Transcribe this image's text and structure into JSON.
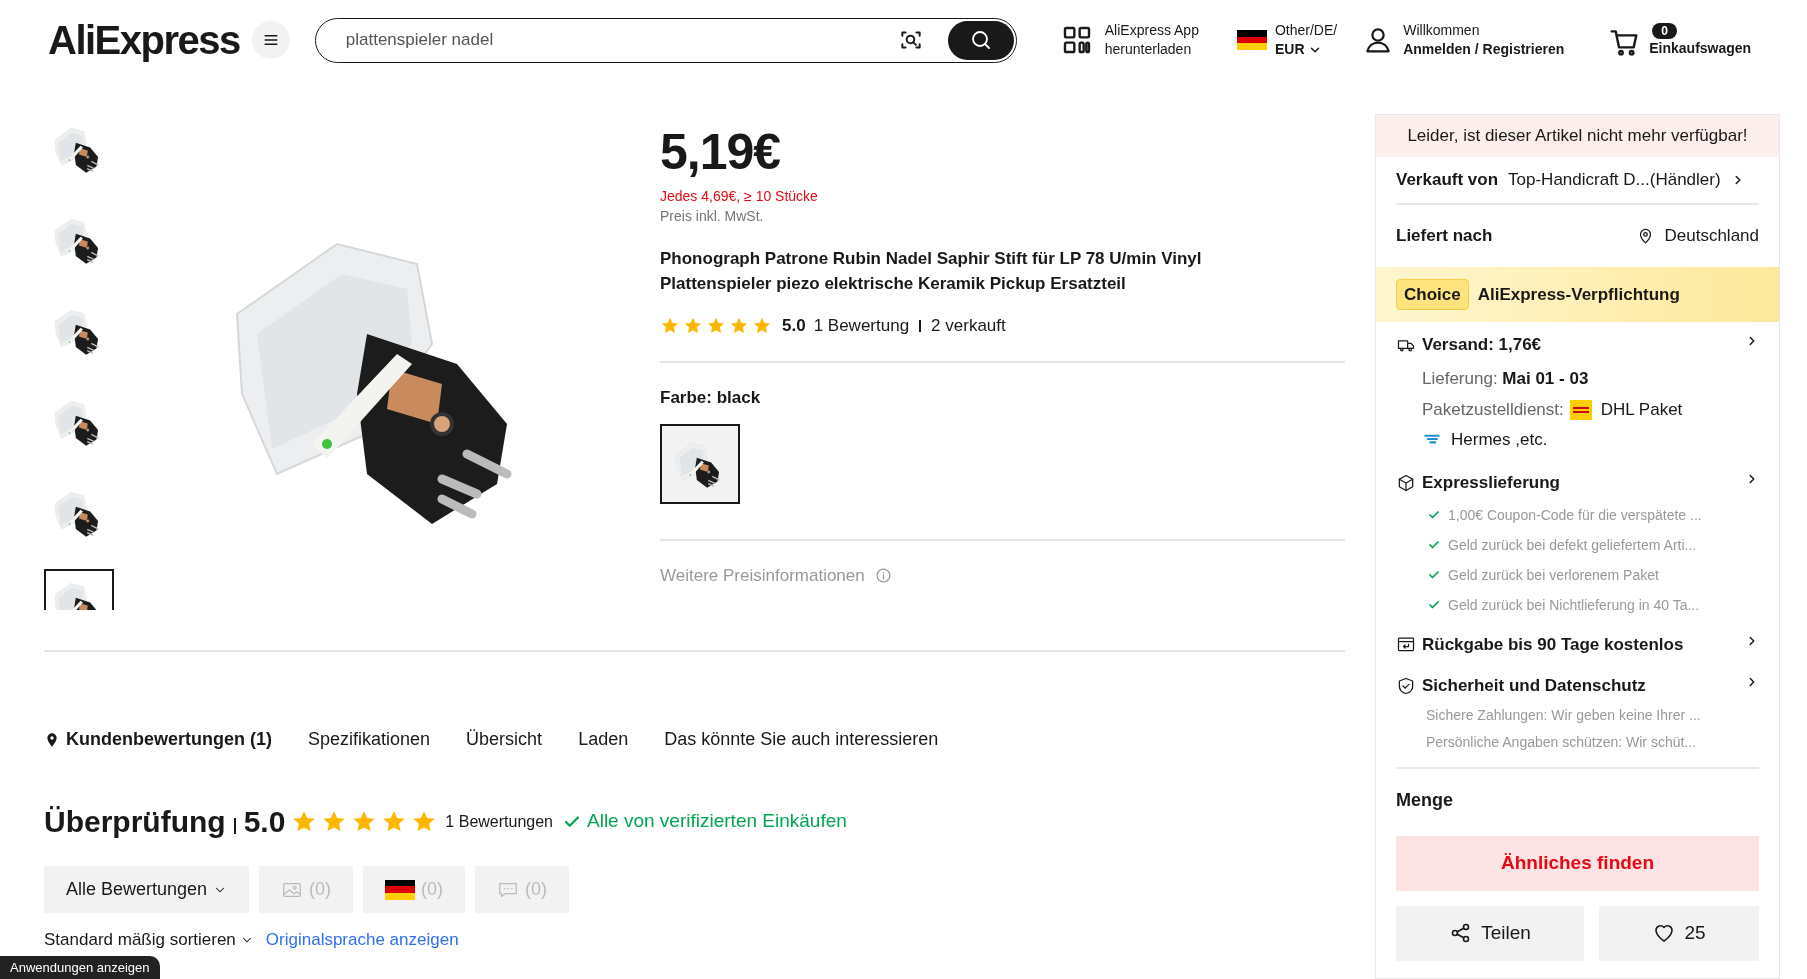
{
  "header": {
    "logo": "AliExpress",
    "search": {
      "value": "plattenspieler nadel"
    },
    "app": {
      "line1": "AliExpress App",
      "line2": "herunterladen"
    },
    "region": {
      "line1": "Other/DE/",
      "line2": "EUR"
    },
    "account": {
      "line1": "Willkommen",
      "line2": "Anmelden / Registrieren"
    },
    "cart": {
      "count": "0",
      "label": "Einkaufswagen"
    }
  },
  "gallery": [
    {
      "selected": false
    },
    {
      "selected": false
    },
    {
      "selected": false
    },
    {
      "selected": false
    },
    {
      "selected": false
    },
    {
      "selected": true
    }
  ],
  "product": {
    "price": "5,19€",
    "bulk_price": "Jedes 4,69€, ≥ 10 Stücke",
    "tax_note": "Preis inkl. MwSt.",
    "title": "Phonograph Patrone Rubin Nadel Saphir Stift für LP 78 U/min Vinyl Plattenspieler piezo elektrische Keramik Pickup Ersatzteil",
    "stars": 5,
    "rating": "5.0",
    "reviews": "1 Bewertung",
    "sold": "2 verkauft",
    "color_label": "Farbe: black",
    "variants": [
      {
        "selected": true
      }
    ],
    "more_price_info": "Weitere Preisinformationen"
  },
  "panel": {
    "notice": "Leider, ist dieser Artikel nicht mehr verfügbar!",
    "seller_label": "Verkauft von",
    "seller_name": "Top-Handicraft D...(Händler)",
    "ship_to_label": "Liefert nach",
    "ship_to": "Deutschland",
    "choice_badge": "Choice",
    "choice_title": "AliExpress-Verpflichtung",
    "shipping": {
      "title": "Versand: 1,76€",
      "delivery_label": "Lieferung:",
      "delivery_date": "Mai 01 - 03",
      "carrier_label": "Paketzustelldienst:",
      "carriers": [
        {
          "kind": "dhl",
          "name": "DHL Paket"
        },
        {
          "kind": "hermes",
          "name": "Hermes ,etc."
        }
      ]
    },
    "sections": [
      {
        "kind": "express",
        "title": "Expresslieferung",
        "points": [
          "1,00€ Coupon-Code für die verspätete ...",
          "Geld zurück bei defekt geliefertem Arti...",
          "Geld zurück bei verlorenem Paket",
          "Geld zurück bei Nichtlieferung in 40 Ta..."
        ]
      },
      {
        "kind": "return",
        "title": "Rückgabe bis 90 Tage kostenlos"
      },
      {
        "kind": "security",
        "title": "Sicherheit und Datenschutz",
        "notes": [
          "Sichere Zahlungen: Wir geben keine Ihrer ...",
          "Persönliche Angaben schützen: Wir schüt..."
        ]
      }
    ],
    "quantity_label": "Menge",
    "find_similar": "Ähnliches finden",
    "share": "Teilen",
    "wishlist": "25"
  },
  "tabs": [
    {
      "label": "Kundenbewertungen (1)",
      "selected": true
    },
    {
      "label": "Spezifikationen",
      "selected": false
    },
    {
      "label": "Übersicht",
      "selected": false
    },
    {
      "label": "Laden",
      "selected": false
    },
    {
      "label": "Das könnte Sie auch interessieren",
      "selected": false
    }
  ],
  "reviews": {
    "title": "Überprüfung",
    "rating": "5.0",
    "stars": 5,
    "count": "1 Bewertungen",
    "verified": "Alle von verifizierten Einkäufen",
    "filters": [
      {
        "kind": "dropdown",
        "label": "Alle Bewertungen"
      },
      {
        "kind": "photo",
        "label": "(0)"
      },
      {
        "kind": "flag",
        "label": "(0)"
      },
      {
        "kind": "comment",
        "label": "(0)"
      }
    ],
    "sort": "Standard mäßig sortieren",
    "translate": "Originalsprache anzeigen"
  },
  "tooltip": "Anwendungen anzeigen"
}
